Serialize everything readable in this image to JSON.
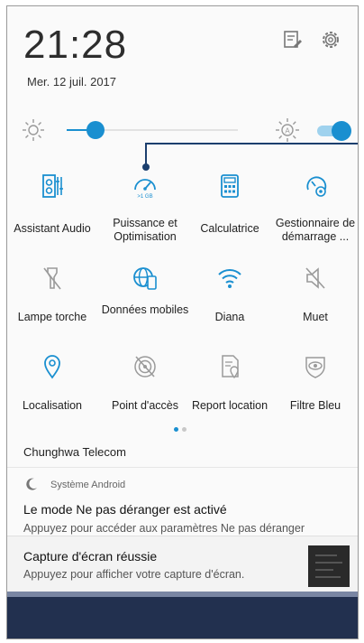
{
  "status": {
    "time": "21:28",
    "date": "Mer. 12 juil. 2017"
  },
  "header_icons": [
    "edit-note-icon",
    "gear-icon"
  ],
  "brightness": {
    "level_percent": 17,
    "auto": true
  },
  "colors": {
    "accent": "#1a8fd0",
    "callout": "#1c3f6e",
    "bottom_bar": "#22304f"
  },
  "quick_settings": [
    {
      "label": "Assistant Audio",
      "icon": "audio-wizard-icon",
      "active": true
    },
    {
      "label": "Puissance et Optimisation",
      "icon": "speedometer-icon",
      "active": true
    },
    {
      "label": "Calculatrice",
      "icon": "calculator-icon",
      "active": true
    },
    {
      "label": "Gestionnaire de démarrage ...",
      "icon": "startup-manager-icon",
      "active": true
    },
    {
      "label": "Lampe torche",
      "icon": "flashlight-off-icon",
      "active": false
    },
    {
      "label": "Données mobiles",
      "icon": "mobile-data-icon",
      "active": true
    },
    {
      "label": "Diana",
      "icon": "wifi-icon",
      "active": true
    },
    {
      "label": "Muet",
      "icon": "mute-icon",
      "active": false
    },
    {
      "label": "Localisation",
      "icon": "location-icon",
      "active": true
    },
    {
      "label": "Point d'accès",
      "icon": "hotspot-off-icon",
      "active": false
    },
    {
      "label": "Report location",
      "icon": "report-location-icon",
      "active": false
    },
    {
      "label": "Filtre Bleu",
      "icon": "blue-filter-icon",
      "active": false
    }
  ],
  "page_indicator": {
    "pages": 2,
    "current": 1
  },
  "carrier": "Chunghwa Telecom",
  "notifications": [
    {
      "app": "Système Android",
      "icon": "moon-icon",
      "title": "Le mode Ne pas déranger est activé",
      "text": "Appuyez pour accéder aux paramètres Ne pas déranger"
    },
    {
      "title": "Capture d'écran réussie",
      "text": "Appuyez pour afficher votre capture d'écran."
    }
  ]
}
